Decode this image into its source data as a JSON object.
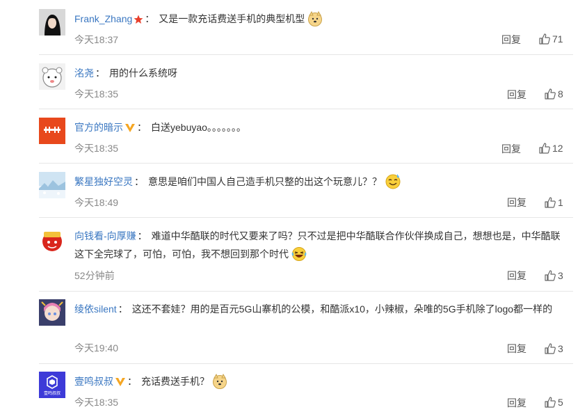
{
  "comments": [
    {
      "user": "Frank_Zhang",
      "text": "又是一款充话费送手机的典型机型",
      "time": "今天18:37",
      "reply": "回复",
      "likes": "71"
    },
    {
      "user": "洺尧",
      "text": "用的什么系统呀",
      "time": "今天18:35",
      "reply": "回复",
      "likes": "8"
    },
    {
      "user": "官方的暗示",
      "text": "白送yebuyao。。。。。。。",
      "time": "今天18:35",
      "reply": "回复",
      "likes": "12"
    },
    {
      "user": "繁星独好空灵",
      "text": "意思是咱们中国人自己造手机只整的出这个玩意儿？？",
      "time": "今天18:49",
      "reply": "回复",
      "likes": "1"
    },
    {
      "user": "向钱看-向厚赚",
      "text": "难道中华酷联的时代又要来了吗？只不过是把中华酷联合作伙伴换成自己，想想也是，中华酷联这下全完球了，可怕，可怕，我不想回到那个时代",
      "time": "52分钟前",
      "reply": "回复",
      "likes": "3"
    },
    {
      "user": "绫依silent",
      "text": "这还不套娃？用的是百元5G山寨机的公模，和酷派x10，小辣椒，朵唯的5G手机除了logo都一样的",
      "time": "今天19:40",
      "reply": "回复",
      "likes": "3"
    },
    {
      "user": "壹鸣叔叔",
      "text": "充话费送手机？",
      "time": "今天18:35",
      "reply": "回复",
      "likes": "5",
      "avatar_text": "壹鸣叔叔"
    }
  ],
  "colors": {
    "username": "#3a77c1",
    "timestamp": "#888888",
    "divider": "#e6e6e6",
    "badge_vip": "#f5a623",
    "badge_star": "#e8402c"
  }
}
